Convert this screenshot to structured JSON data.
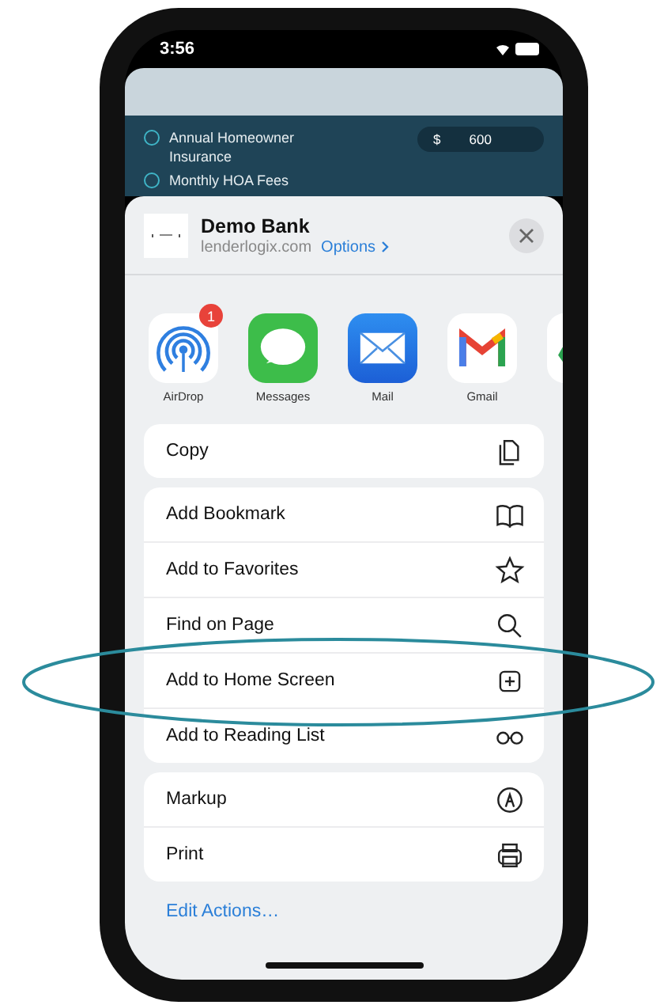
{
  "status_bar": {
    "time": "3:56"
  },
  "background_app": {
    "rows": [
      {
        "label": "Annual Homeowner Insurance",
        "currency": "$",
        "value": "600",
        "selected": false
      },
      {
        "label": "Monthly HOA Fees",
        "selected": false
      }
    ]
  },
  "share_sheet": {
    "title": "Demo Bank",
    "url": "lenderlogix.com",
    "options_link": "Options",
    "apps": [
      {
        "kind": "airdrop",
        "label": "AirDrop",
        "badge": "1"
      },
      {
        "kind": "messages",
        "label": "Messages"
      },
      {
        "kind": "mail",
        "label": "Mail"
      },
      {
        "kind": "gmail",
        "label": "Gmail"
      },
      {
        "kind": "drive"
      }
    ],
    "action_groups": [
      [
        {
          "label": "Copy",
          "kind": "copy",
          "highlighted": false
        }
      ],
      [
        {
          "label": "Add Bookmark",
          "kind": "book",
          "highlighted": false
        },
        {
          "label": "Add to Favorites",
          "kind": "star",
          "highlighted": false
        },
        {
          "label": "Find on Page",
          "kind": "search",
          "highlighted": false
        },
        {
          "label": "Add to Home Screen",
          "kind": "plus-square",
          "highlighted": true
        },
        {
          "label": "Add to Reading List",
          "kind": "glasses",
          "highlighted": false
        }
      ],
      [
        {
          "label": "Markup",
          "kind": "markup",
          "highlighted": false
        },
        {
          "label": "Print",
          "kind": "print",
          "highlighted": false
        }
      ]
    ],
    "edit_actions": "Edit Actions…"
  }
}
